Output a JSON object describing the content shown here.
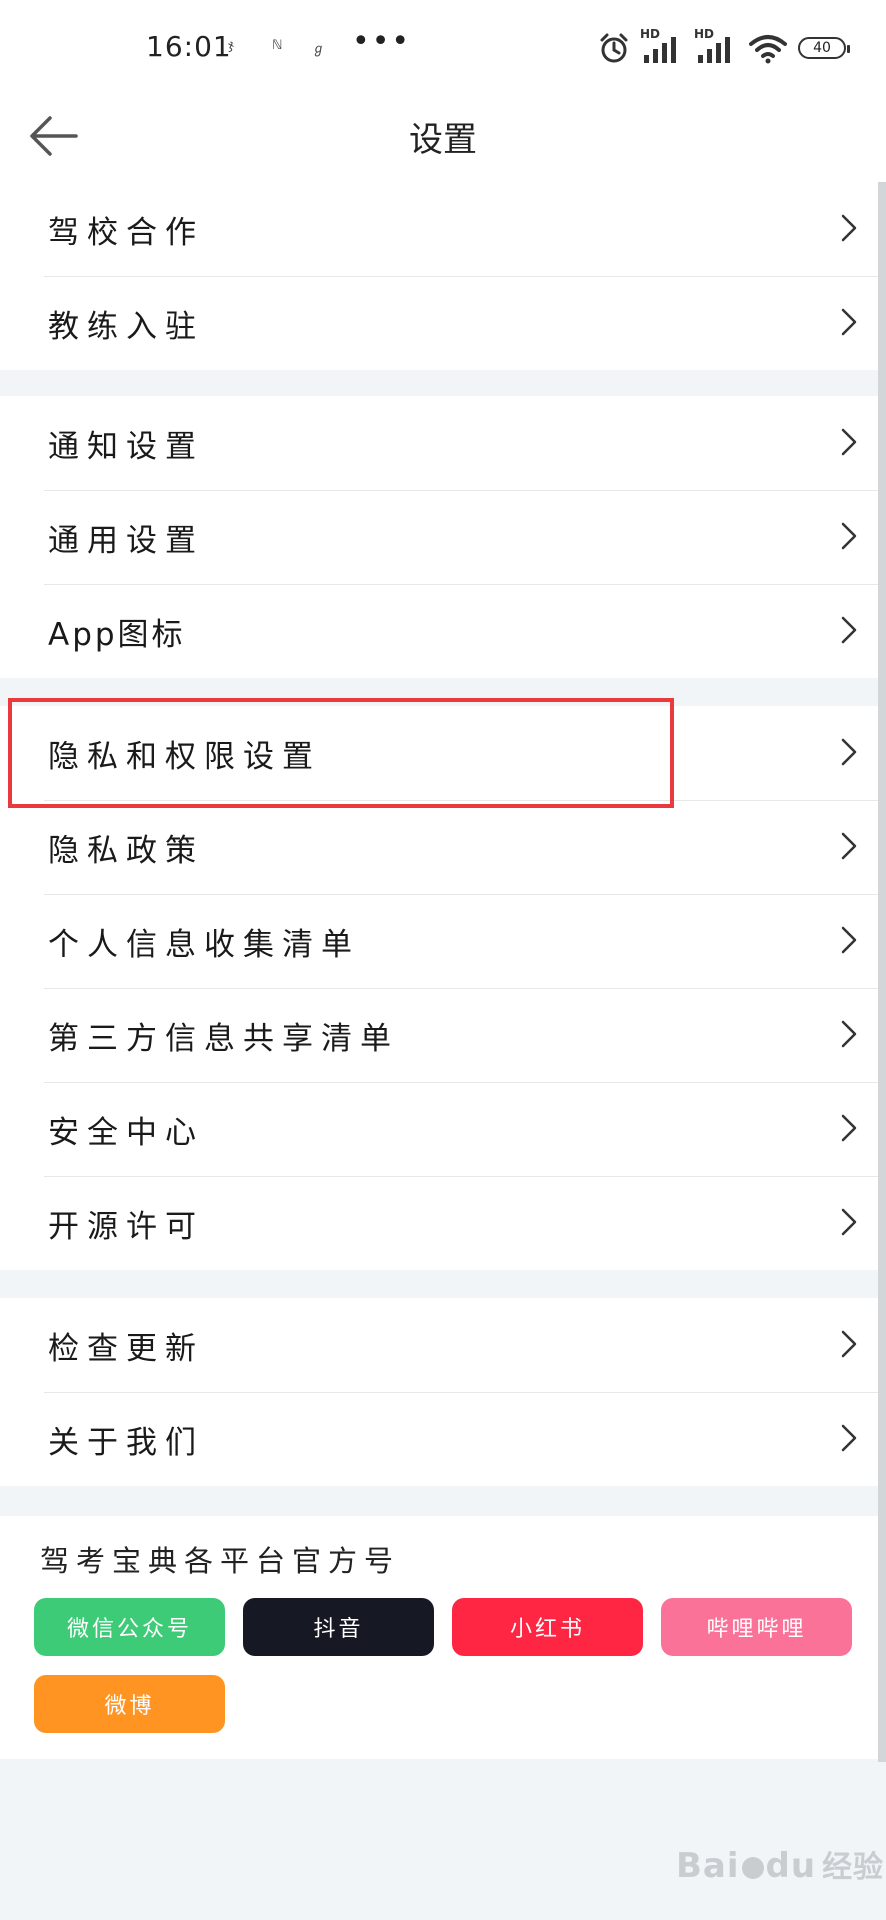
{
  "status_bar": {
    "time": "16:01",
    "mini_icons": [
      "ჯ",
      "ℕ",
      "ℊ"
    ],
    "dots": "•••",
    "network_label_1": "HD",
    "network_label_2": "HD",
    "battery": "40"
  },
  "header": {
    "title": "设置"
  },
  "groups": [
    {
      "items": [
        "驾校合作",
        "教练入驻"
      ]
    },
    {
      "items": [
        "通知设置",
        "通用设置",
        "App图标"
      ]
    },
    {
      "items": [
        "隐私和权限设置",
        "隐私政策",
        "个人信息收集清单",
        "第三方信息共享清单",
        "安全中心",
        "开源许可"
      ]
    },
    {
      "items": [
        "检查更新",
        "关于我们"
      ]
    }
  ],
  "social": {
    "title": "驾考宝典各平台官方号",
    "buttons": [
      {
        "label": "微信公众号",
        "color": "#3ecb77"
      },
      {
        "label": "抖音",
        "color": "#161823"
      },
      {
        "label": "小红书",
        "color": "#fe2643"
      },
      {
        "label": "哔哩哔哩",
        "color": "#fb7299"
      },
      {
        "label": "微博",
        "color": "#ff9423"
      }
    ]
  },
  "watermark": {
    "brand": "Bai",
    "brand_2": "du",
    "text": "经验"
  },
  "colors": {
    "highlight": "#ea3a3d",
    "background": "#f1f5f8"
  }
}
